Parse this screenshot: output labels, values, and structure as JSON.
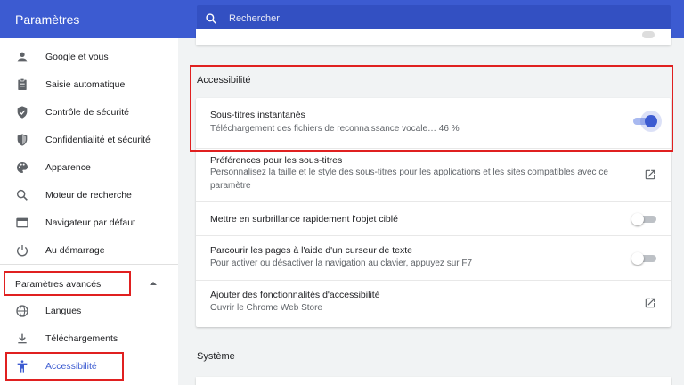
{
  "header": {
    "title": "Paramètres",
    "search_placeholder": "Rechercher"
  },
  "sidebar": {
    "items": [
      {
        "label": "Google et vous",
        "icon": "person-icon"
      },
      {
        "label": "Saisie automatique",
        "icon": "clipboard-icon"
      },
      {
        "label": "Contrôle de sécurité",
        "icon": "shield-check-icon"
      },
      {
        "label": "Confidentialité et sécurité",
        "icon": "shield-icon"
      },
      {
        "label": "Apparence",
        "icon": "palette-icon"
      },
      {
        "label": "Moteur de recherche",
        "icon": "search-icon"
      },
      {
        "label": "Navigateur par défaut",
        "icon": "browser-icon"
      },
      {
        "label": "Au démarrage",
        "icon": "power-icon"
      }
    ],
    "advanced_label": "Paramètres avancés",
    "advanced_items": [
      {
        "label": "Langues",
        "icon": "globe-icon"
      },
      {
        "label": "Téléchargements",
        "icon": "download-icon"
      },
      {
        "label": "Accessibilité",
        "icon": "accessibility-icon"
      }
    ]
  },
  "main": {
    "accessibility_title": "Accessibilité",
    "rows": [
      {
        "title": "Sous-titres instantanés",
        "subtitle": "Téléchargement des fichiers de reconnaissance vocale… 46 %",
        "control": "toggle-on"
      },
      {
        "title": "Préférences pour les sous-titres",
        "subtitle": "Personnalisez la taille et le style des sous-titres pour les applications et les sites compatibles avec ce paramètre",
        "control": "external-link"
      },
      {
        "title": "Mettre en surbrillance rapidement l'objet ciblé",
        "subtitle": "",
        "control": "toggle-off"
      },
      {
        "title": "Parcourir les pages à l'aide d'un curseur de texte",
        "subtitle": "Pour activer ou désactiver la navigation au clavier, appuyez sur F7",
        "control": "toggle-off"
      },
      {
        "title": "Ajouter des fonctionnalités d'accessibilité",
        "subtitle": "Ouvrir le Chrome Web Store",
        "control": "external-link"
      }
    ],
    "system_title": "Système"
  },
  "colors": {
    "accent": "#3c5bd1",
    "highlight": "#e02020"
  }
}
